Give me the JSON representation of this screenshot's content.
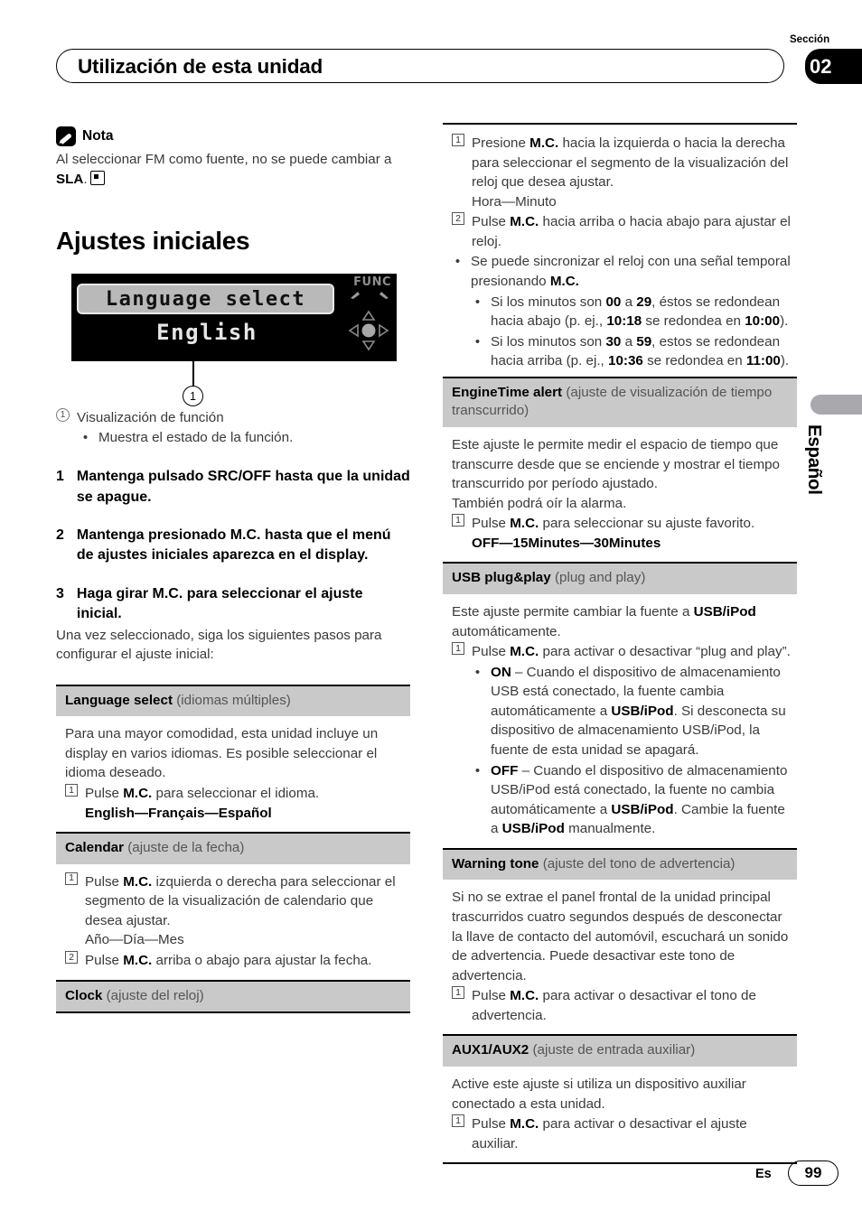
{
  "header": {
    "title": "Utilización de esta unidad",
    "section_label": "Sección",
    "section_number": "02"
  },
  "side_tab": {
    "language": "Español"
  },
  "footer": {
    "lang_code": "Es",
    "page_number": "99"
  },
  "left_column": {
    "nota": {
      "title": "Nota",
      "text_1": "Al seleccionar FM como fuente, no se puede cambiar a ",
      "bold_1": "SLA",
      "text_2": "."
    },
    "heading": "Ajustes iniciales",
    "lcd": {
      "line_1": "Language select",
      "line_2": "English",
      "func_label": "FUNC",
      "callout": "1"
    },
    "callout_list": {
      "num": "1",
      "label": "Visualización de función",
      "bullet": "Muestra el estado de la función."
    },
    "steps": [
      {
        "num": "1",
        "text": "Mantenga pulsado SRC/OFF hasta que la unidad se apague."
      },
      {
        "num": "2",
        "text": "Mantenga presionado M.C. hasta que el menú de ajustes iniciales aparezca en el display."
      },
      {
        "num": "3",
        "text": "Haga girar M.C. para seleccionar el ajuste inicial."
      }
    ],
    "after_step3": "Una vez seleccionado, siga los siguientes pasos para configurar el ajuste inicial:",
    "settings": [
      {
        "name": "language-select",
        "title": "Language select",
        "subtitle": "(idiomas múltiples)",
        "intro": "Para una mayor comodidad, esta unidad incluye un display en varios idiomas. Es posible seleccionar el idioma deseado.",
        "step_num": "1",
        "step_pre": "Pulse ",
        "step_bold": "M.C.",
        "step_post": " para seleccionar el idioma.",
        "options": "English—Français—Español"
      },
      {
        "name": "calendar",
        "title": "Calendar",
        "subtitle": "(ajuste de la fecha)",
        "step1_num": "1",
        "step1_pre": "Pulse ",
        "step1_bold": "M.C.",
        "step1_post": " izquierda o derecha para seleccionar el segmento de la visualización de calendario que desea ajustar.",
        "step1_options": "Año—Día—Mes",
        "step2_num": "2",
        "step2_pre": "Pulse ",
        "step2_bold": "M.C.",
        "step2_post": " arriba o abajo para ajustar la fecha."
      },
      {
        "name": "clock",
        "title": "Clock",
        "subtitle": "(ajuste del reloj)"
      }
    ]
  },
  "right_column": {
    "clock_steps": {
      "step1_num": "1",
      "step1_pre": "Presione ",
      "step1_bold": "M.C.",
      "step1_post": " hacia la izquierda o hacia la derecha para seleccionar el segmento de la visualización del reloj que desea ajustar.",
      "step1_options": "Hora—Minuto",
      "step2_num": "2",
      "step2_pre": "Pulse ",
      "step2_bold": "M.C.",
      "step2_post": " hacia arriba o hacia abajo para ajustar el reloj.",
      "bullet_pre": "Se puede sincronizar el reloj con una señal temporal presionando ",
      "bullet_bold": "M.C.",
      "bullet_post": "",
      "sub_bullets": [
        {
          "p1": "Si los minutos son ",
          "b1": "00",
          "p2": " a ",
          "b2": "29",
          "p3": ", éstos se redondean hacia abajo (p. ej., ",
          "b3": "10:18",
          "p4": " se redondea en ",
          "b4": "10:00",
          "p5": ")."
        },
        {
          "p1": "Si los minutos son ",
          "b1": "30",
          "p2": " a ",
          "b2": "59",
          "p3": ", estos se redondean hacia arriba (p. ej., ",
          "b3": "10:36",
          "p4": " se redondea en ",
          "b4": "11:00",
          "p5": ")."
        }
      ]
    },
    "settings": [
      {
        "name": "enginetime-alert",
        "title": "EngineTime alert",
        "subtitle": "(ajuste de visualización de tiempo transcurrido)",
        "intro_1": "Este ajuste le permite medir el espacio de tiempo que transcurre desde que se enciende y mostrar el tiempo transcurrido por período ajustado.",
        "intro_2": "También podrá oír la alarma.",
        "step_num": "1",
        "step_pre": "Pulse ",
        "step_bold": "M.C.",
        "step_post": " para seleccionar su ajuste favorito.",
        "options": "OFF—15Minutes—30Minutes"
      },
      {
        "name": "usb-plug-and-play",
        "title": "USB plug&play",
        "subtitle": "(plug and play)",
        "intro_pre": "Este ajuste permite cambiar la fuente a ",
        "intro_bold": "USB/iPod",
        "intro_post": " automáticamente.",
        "step_num": "1",
        "step_pre": "Pulse ",
        "step_bold": "M.C.",
        "step_post": " para activar o desactivar “plug and play”.",
        "on_bold": "ON",
        "on_text": " – Cuando el dispositivo de almacenamiento USB está conectado, la fuente cambia automáticamente a ",
        "on_bold2": "USB/iPod",
        "on_text2": ". Si desconecta su dispositivo de almacenamiento USB/iPod, la fuente de esta unidad se apagará.",
        "off_bold": "OFF",
        "off_text": " – Cuando el dispositivo de almacenamiento USB/iPod está conectado, la fuente no cambia automáticamente a ",
        "off_bold2": "USB/iPod",
        "off_text2": ". Cambie la fuente a ",
        "off_bold3": "USB/iPod",
        "off_text3": " manualmente."
      },
      {
        "name": "warning-tone",
        "title": "Warning tone",
        "subtitle": "(ajuste del tono de advertencia)",
        "intro": "Si no se extrae el panel frontal de la unidad principal trascurridos cuatro segundos después de desconectar la llave de contacto del automóvil, escuchará un sonido de advertencia. Puede desactivar este tono de advertencia.",
        "step_num": "1",
        "step_pre": "Pulse ",
        "step_bold": "M.C.",
        "step_post": " para activar o desactivar el tono de advertencia."
      },
      {
        "name": "aux1-aux2",
        "title": "AUX1/AUX2",
        "subtitle": "(ajuste de entrada auxiliar)",
        "intro": "Active este ajuste si utiliza un dispositivo auxiliar conectado a esta unidad.",
        "step_num": "1",
        "step_pre": "Pulse ",
        "step_bold": "M.C.",
        "step_post": " para activar o desactivar el ajuste auxiliar."
      }
    ]
  }
}
